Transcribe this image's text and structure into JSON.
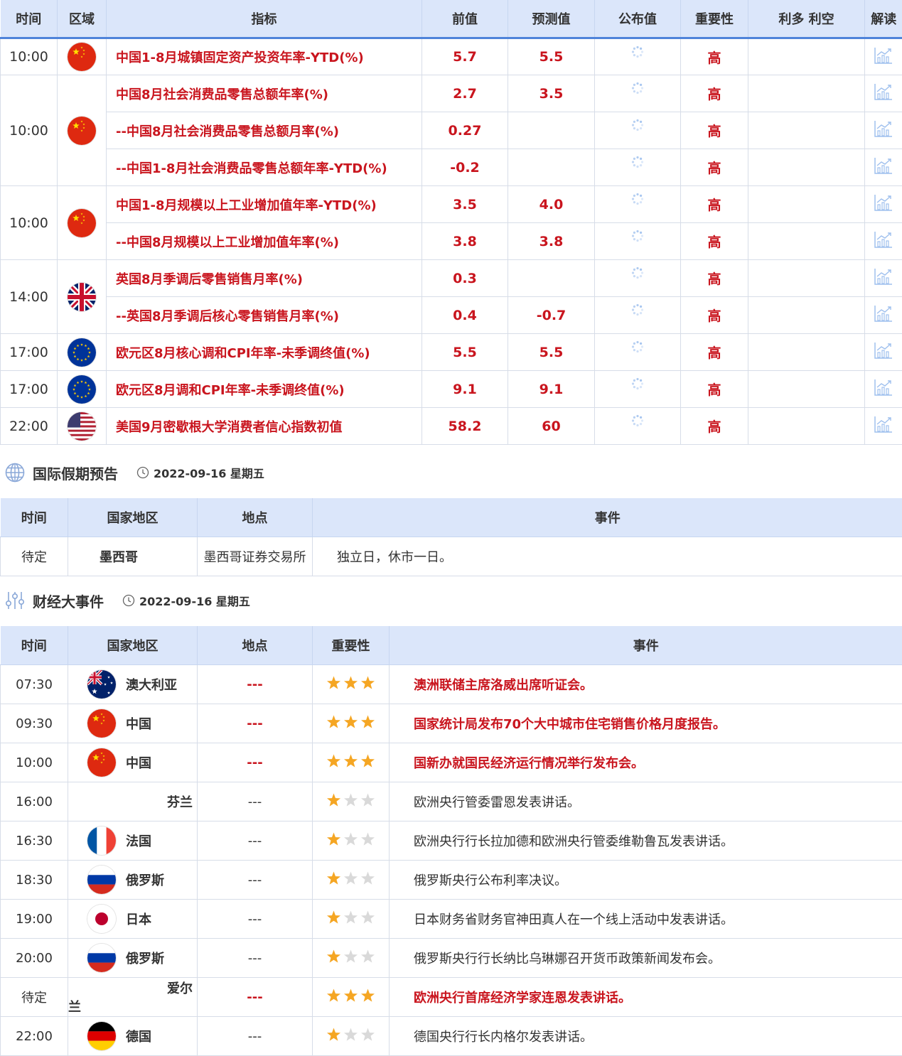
{
  "eco_table": {
    "headers": [
      "时间",
      "区域",
      "指标",
      "前值",
      "预测值",
      "公布值",
      "重要性",
      "利多 利空",
      "解读"
    ],
    "groups": [
      {
        "time": "10:00",
        "flag": "china-flag",
        "rows": [
          {
            "indicator": "中国1-8月城镇固定资产投资年率-YTD(%)",
            "previous": "5.7",
            "forecast": "5.5",
            "importance": "高"
          }
        ]
      },
      {
        "time": "10:00",
        "flag": "china-flag",
        "rows": [
          {
            "indicator": "中国8月社会消费品零售总额年率(%)",
            "previous": "2.7",
            "forecast": "3.5",
            "importance": "高"
          },
          {
            "indicator": "--中国8月社会消费品零售总额月率(%)",
            "previous": "0.27",
            "forecast": "",
            "importance": "高"
          },
          {
            "indicator": "--中国1-8月社会消费品零售总额年率-YTD(%)",
            "previous": "-0.2",
            "forecast": "",
            "importance": "高"
          }
        ]
      },
      {
        "time": "10:00",
        "flag": "china-flag",
        "rows": [
          {
            "indicator": "中国1-8月规模以上工业增加值年率-YTD(%)",
            "previous": "3.5",
            "forecast": "4.0",
            "importance": "高"
          },
          {
            "indicator": "--中国8月规模以上工业增加值年率(%)",
            "previous": "3.8",
            "forecast": "3.8",
            "importance": "高"
          }
        ]
      },
      {
        "time": "14:00",
        "flag": "uk-flag",
        "rows": [
          {
            "indicator": "英国8月季调后零售销售月率(%)",
            "previous": "0.3",
            "forecast": "",
            "importance": "高"
          },
          {
            "indicator": "--英国8月季调后核心零售销售月率(%)",
            "previous": "0.4",
            "forecast": "-0.7",
            "importance": "高"
          }
        ]
      },
      {
        "time": "17:00",
        "flag": "eu-flag",
        "rows": [
          {
            "indicator": "欧元区8月核心调和CPI年率-未季调终值(%)",
            "previous": "5.5",
            "forecast": "5.5",
            "importance": "高"
          }
        ]
      },
      {
        "time": "17:00",
        "flag": "eu-flag",
        "rows": [
          {
            "indicator": "欧元区8月调和CPI年率-未季调终值(%)",
            "previous": "9.1",
            "forecast": "9.1",
            "importance": "高"
          }
        ]
      },
      {
        "time": "22:00",
        "flag": "us-flag",
        "rows": [
          {
            "indicator": "美国9月密歇根大学消费者信心指数初值",
            "previous": "58.2",
            "forecast": "60",
            "importance": "高"
          }
        ]
      }
    ]
  },
  "holiday_section": {
    "title": "国际假期预告",
    "date": "2022-09-16 星期五",
    "headers": [
      "时间",
      "国家地区",
      "地点",
      "事件"
    ],
    "rows": [
      {
        "time": "待定",
        "country": "墨西哥",
        "location": "墨西哥证券交易所",
        "event": "独立日，休市一日。"
      }
    ]
  },
  "events_section": {
    "title": "财经大事件",
    "date": "2022-09-16 星期五",
    "headers": [
      "时间",
      "国家地区",
      "地点",
      "重要性",
      "事件"
    ],
    "rows": [
      {
        "time": "07:30",
        "flag": "australia-flag",
        "country": "澳大利亚",
        "location": "---",
        "stars": 3,
        "event": "澳洲联储主席洛威出席听证会。"
      },
      {
        "time": "09:30",
        "flag": "china-flag",
        "country": "中国",
        "location": "---",
        "stars": 3,
        "event": "国家统计局发布70个大中城市住宅销售价格月度报告。"
      },
      {
        "time": "10:00",
        "flag": "china-flag",
        "country": "中国",
        "location": "---",
        "stars": 3,
        "event": "国新办就国民经济运行情况举行发布会。"
      },
      {
        "time": "16:00",
        "flag": "",
        "country": "芬兰",
        "location": "---",
        "stars": 1,
        "event": "欧洲央行管委雷恩发表讲话。"
      },
      {
        "time": "16:30",
        "flag": "france-flag",
        "country": "法国",
        "location": "---",
        "stars": 1,
        "event": "欧洲央行行长拉加德和欧洲央行管委维勒鲁瓦发表讲话。"
      },
      {
        "time": "18:30",
        "flag": "russia-flag",
        "country": "俄罗斯",
        "location": "---",
        "stars": 1,
        "event": "俄罗斯央行公布利率决议。"
      },
      {
        "time": "19:00",
        "flag": "japan-flag",
        "country": "日本",
        "location": "---",
        "stars": 1,
        "event": "日本财务省财务官神田真人在一个线上活动中发表讲话。"
      },
      {
        "time": "20:00",
        "flag": "russia-flag",
        "country": "俄罗斯",
        "location": "---",
        "stars": 1,
        "event": "俄罗斯央行行长纳比乌琳娜召开货币政策新闻发布会。"
      },
      {
        "time": "待定",
        "flag": "",
        "country": "爱尔兰",
        "location": "---",
        "stars": 3,
        "event": "欧洲央行首席经济学家连恩发表讲话。"
      },
      {
        "time": "22:00",
        "flag": "germany-flag",
        "country": "德国",
        "location": "---",
        "stars": 1,
        "event": "德国央行行长内格尔发表讲话。"
      }
    ]
  },
  "colors": {
    "accent_red": "#c9151e",
    "header_bg": "#dbe6fa",
    "header_line": "#4f84da",
    "star_on": "#f5a623",
    "star_off": "#d9d9d9"
  }
}
